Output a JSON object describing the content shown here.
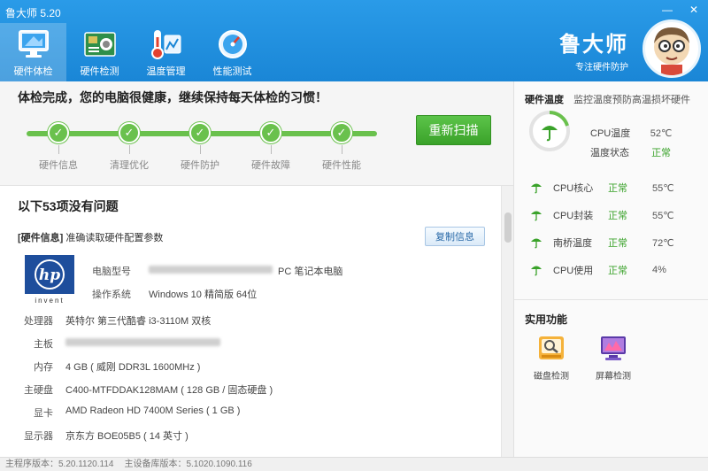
{
  "window": {
    "title": "鲁大师 5.20",
    "minimize": "—",
    "close": "✕"
  },
  "nav": [
    {
      "label": "硬件体检",
      "icon": "monitor-icon",
      "active": true
    },
    {
      "label": "硬件检测",
      "icon": "circuit-board-icon"
    },
    {
      "label": "温度管理",
      "icon": "thermometer-icon"
    },
    {
      "label": "性能测试",
      "icon": "speedometer-icon"
    }
  ],
  "brand": {
    "name": "鲁大师",
    "slogan": "专注硬件防护"
  },
  "status": {
    "message": "体检完成，您的电脑很健康，继续保持每天体检的习惯！",
    "rescan_label": "重新扫描",
    "steps": [
      "硬件信息",
      "清理优化",
      "硬件防护",
      "硬件故障",
      "硬件性能"
    ]
  },
  "content": {
    "section_title": "以下53项没有问题",
    "hw_tag": "[硬件信息]",
    "hw_desc": "准确读取硬件配置参数",
    "copy_label": "复制信息",
    "logo_text": "invent",
    "logo_mark": "hp",
    "model_label": "电脑型号",
    "model_suffix": "PC 笔记本电脑",
    "os_label": "操作系统",
    "os_value": "Windows 10 精简版 64位",
    "specs": [
      {
        "label": "处理器",
        "value": "英特尔 第三代酷睿 i3-3110M 双核"
      },
      {
        "label": "主板",
        "value": ""
      },
      {
        "label": "内存",
        "value": "4 GB ( 威刚 DDR3L 1600MHz )"
      },
      {
        "label": "主硬盘",
        "value": "C400-MTFDDAK128MAM ( 128 GB / 固态硬盘 )"
      },
      {
        "label": "显卡",
        "value": "AMD Radeon HD 7400M Series ( 1 GB )"
      },
      {
        "label": "显示器",
        "value": "京东方 BOE05B5 ( 14 英寸 )"
      }
    ]
  },
  "temperature": {
    "title": "硬件温度",
    "subtitle": "监控温度预防高温损坏硬件",
    "cpu_temp_label": "CPU温度",
    "cpu_temp_value": "52℃",
    "temp_status_label": "温度状态",
    "temp_status_value": "正常",
    "metrics": [
      {
        "label": "CPU核心",
        "status": "正常",
        "value": "55℃"
      },
      {
        "label": "CPU封装",
        "status": "正常",
        "value": "55℃"
      },
      {
        "label": "南桥温度",
        "status": "正常",
        "value": "72℃"
      },
      {
        "label": "CPU使用",
        "status": "正常",
        "value": "4%"
      }
    ]
  },
  "functions": {
    "title": "实用功能",
    "items": [
      {
        "label": "磁盘检测",
        "icon": "disk-check-icon"
      },
      {
        "label": "屏幕检测",
        "icon": "screen-check-icon"
      }
    ]
  },
  "footer": {
    "main_version": "主程序版本：5.20.1120.114",
    "db_version": "主设备库版本：5.1020.1090.116"
  },
  "colors": {
    "header": "#1a86d6",
    "accent_green": "#3aa22a",
    "progress": "#6ac14d"
  }
}
